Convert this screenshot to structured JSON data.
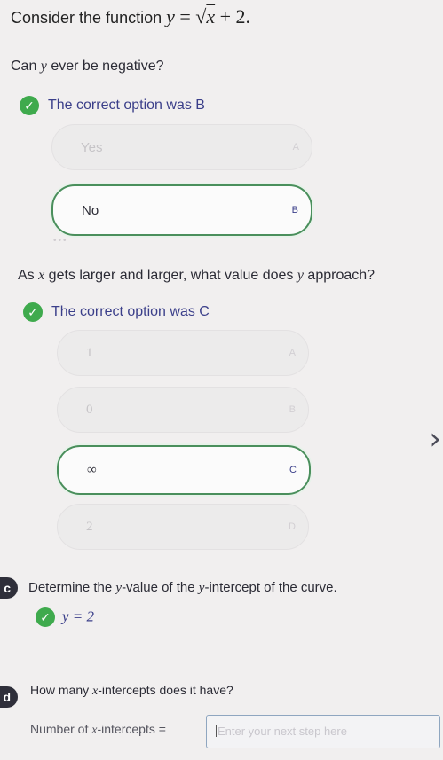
{
  "header": {
    "prefix": "Consider the function ",
    "eq_y": "y",
    "eq_mid": " = √",
    "eq_x": "x",
    "eq_tail": " + 2."
  },
  "q1": {
    "prefix": "Can ",
    "var": "y",
    "suffix": " ever be negative?",
    "correct_text": "The correct option was B",
    "options": [
      {
        "label": "Yes",
        "letter": "A"
      },
      {
        "label": "No",
        "letter": "B"
      }
    ],
    "dots": "•••"
  },
  "q2": {
    "prefix": "As ",
    "var1": "x",
    "mid": " gets larger and larger, what value does ",
    "var2": "y",
    "suffix": " approach?",
    "correct_text": "The correct option was C",
    "options": [
      {
        "label": "1",
        "letter": "A"
      },
      {
        "label": "0",
        "letter": "B"
      },
      {
        "label": "∞",
        "letter": "C"
      },
      {
        "label": "2",
        "letter": "D"
      }
    ]
  },
  "q3": {
    "tag": "c",
    "prefix": "Determine the ",
    "var1": "y",
    "mid": "-value of the ",
    "var2": "y",
    "suffix": "-intercept of the curve.",
    "answer": "y = 2"
  },
  "q4": {
    "tag": "d",
    "prefix": "How many ",
    "var": "x",
    "suffix": "-intercepts does it have?",
    "field_label_prefix": "Number of ",
    "field_label_var": "x",
    "field_label_suffix": "-intercepts =",
    "placeholder": "Enter your next step here"
  },
  "colors": {
    "check_green": "#3faa4d",
    "selected_border": "#4a8f5c",
    "accent_text": "#3b3f8a"
  },
  "icons": {
    "check": "checkmark-icon",
    "chevron": "chevron-right-icon"
  }
}
